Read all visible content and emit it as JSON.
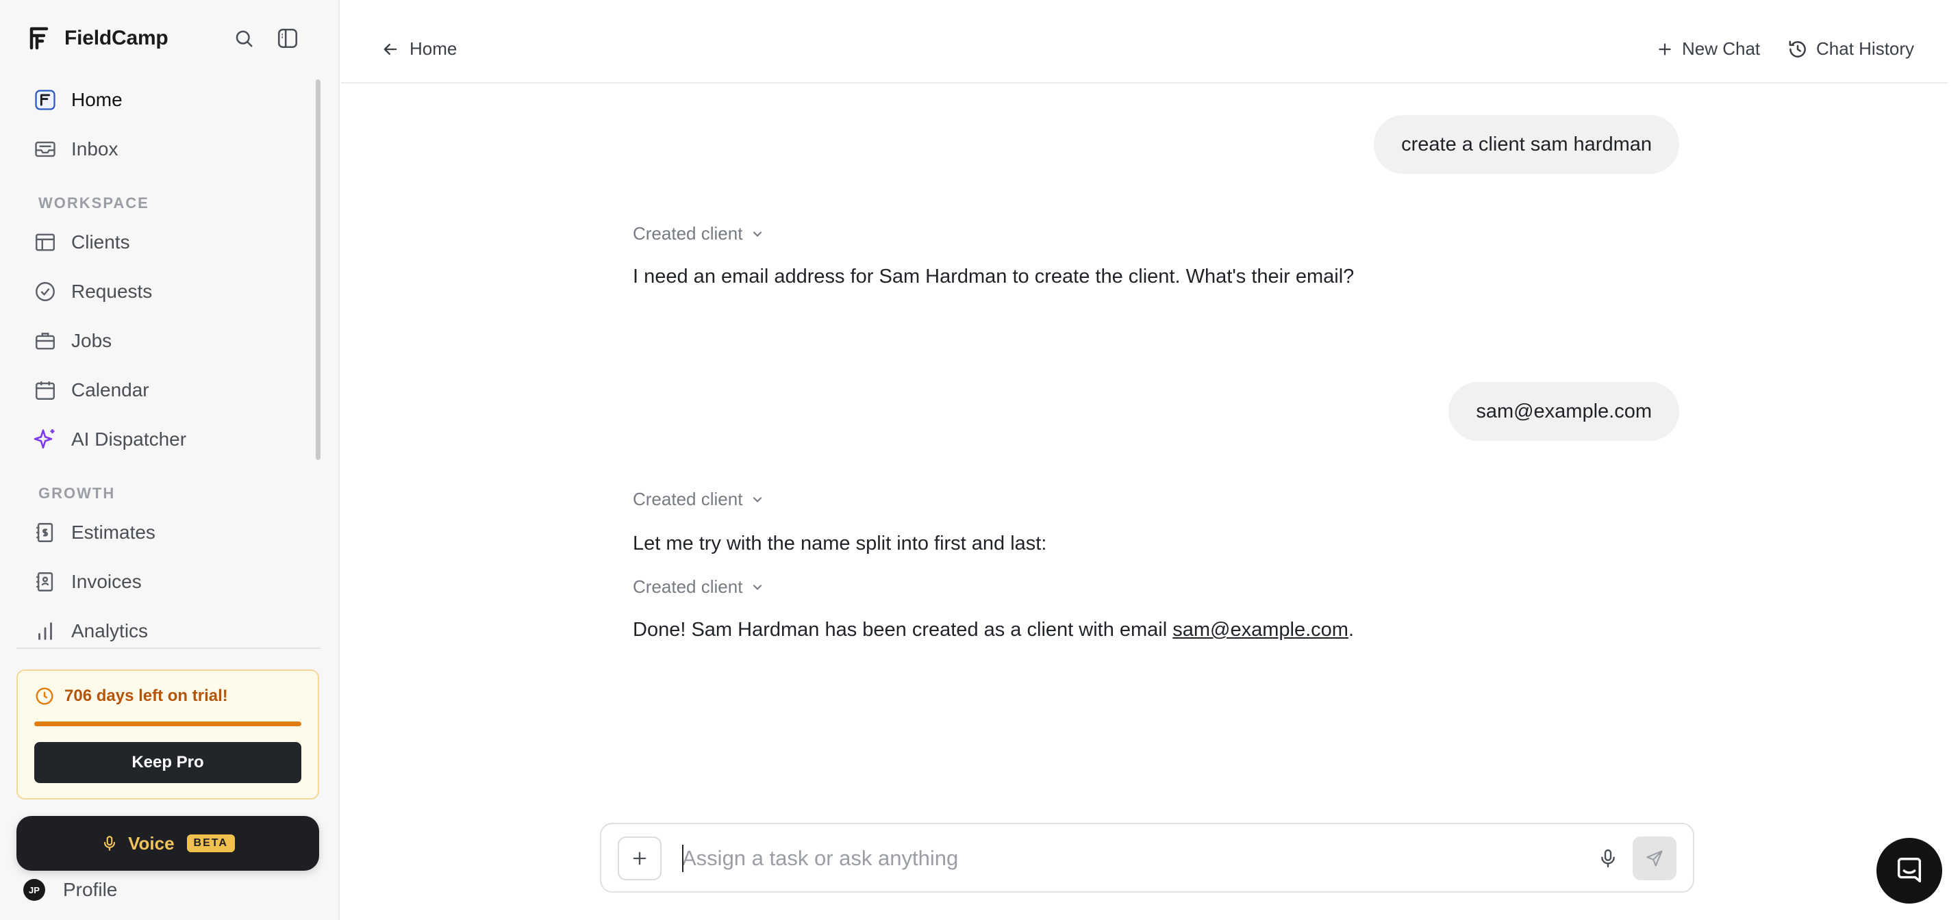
{
  "brand": {
    "name": "FieldCamp"
  },
  "sidebar": {
    "nav_top": [
      {
        "label": "Home",
        "icon": "home-icon",
        "active": true
      },
      {
        "label": "Inbox",
        "icon": "inbox-icon"
      }
    ],
    "workspace_label": "WORKSPACE",
    "workspace": [
      {
        "label": "Clients",
        "icon": "clients-icon"
      },
      {
        "label": "Requests",
        "icon": "requests-icon"
      },
      {
        "label": "Jobs",
        "icon": "jobs-icon"
      },
      {
        "label": "Calendar",
        "icon": "calendar-icon"
      },
      {
        "label": "AI Dispatcher",
        "icon": "sparkles-icon"
      }
    ],
    "growth_label": "GROWTH",
    "growth": [
      {
        "label": "Estimates",
        "icon": "estimates-icon"
      },
      {
        "label": "Invoices",
        "icon": "invoices-icon"
      },
      {
        "label": "Analytics",
        "icon": "analytics-icon"
      }
    ],
    "trial": {
      "text": "706 days left on trial!",
      "progress": 1.0,
      "button": "Keep Pro"
    },
    "voice": {
      "label": "Voice",
      "badge": "BETA"
    },
    "profile": {
      "initials": "JP",
      "label": "Profile"
    }
  },
  "topbar": {
    "back_label": "Home",
    "new_chat": "New Chat",
    "chat_history": "Chat History"
  },
  "chat": {
    "messages": [
      {
        "role": "user",
        "text": "create a client sam hardman"
      },
      {
        "role": "tool",
        "text": "Created client"
      },
      {
        "role": "assistant",
        "text": "I need an email address for Sam Hardman to create the client. What's their email?"
      },
      {
        "role": "user",
        "text": "sam@example.com"
      },
      {
        "role": "tool",
        "text": "Created client"
      },
      {
        "role": "assistant",
        "text": "Let me try with the name split into first and last:"
      },
      {
        "role": "tool",
        "text": "Created client"
      },
      {
        "role": "assistant",
        "text_before": "Done! Sam Hardman has been created as a client with email ",
        "link": "sam@example.com",
        "text_after": "."
      }
    ]
  },
  "composer": {
    "placeholder": "Assign a task or ask anything",
    "value": ""
  },
  "colors": {
    "accent": "#7c3aed",
    "trial_text": "#b4540a",
    "trial_bar": "#df7d10",
    "voice": "#f2c35a"
  }
}
